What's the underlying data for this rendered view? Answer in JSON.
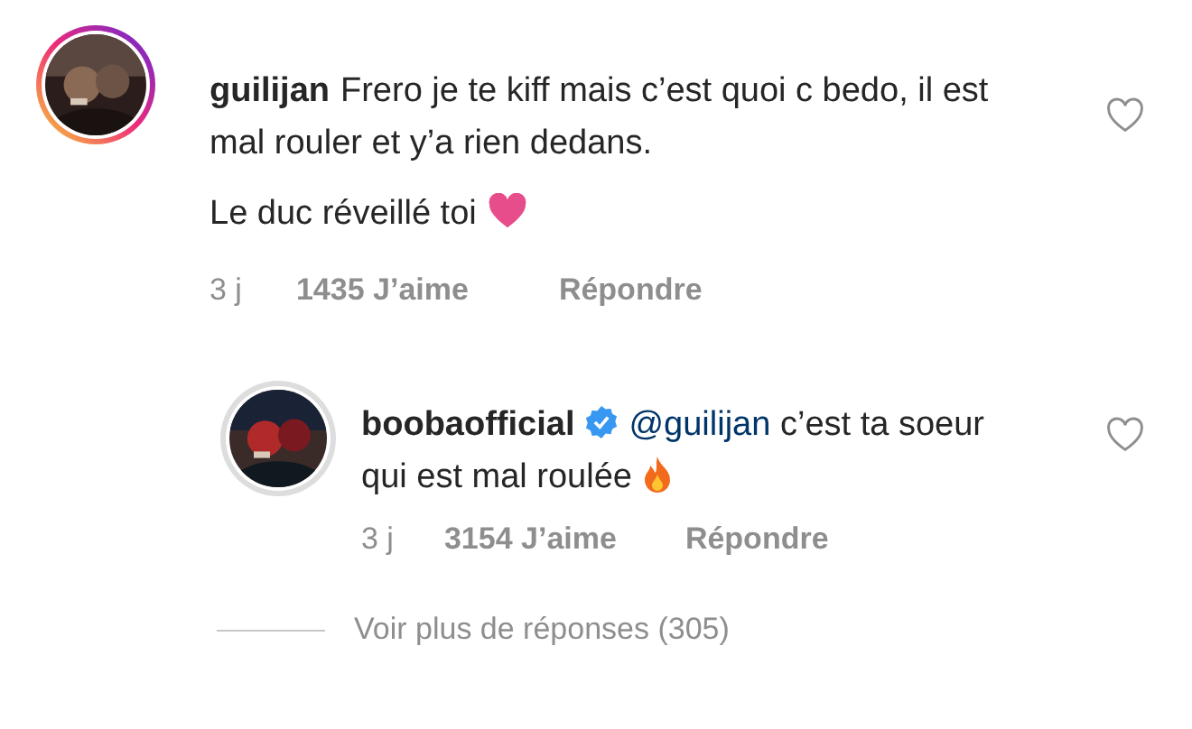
{
  "comments": [
    {
      "username": "guilijan",
      "verified": false,
      "story_ring": true,
      "lines": [
        "Frero je te kiff mais c’est quoi c bedo, il est mal rouler et y’a rien dedans.",
        "Le duc réveillé toi"
      ],
      "end_icon": {
        "kind": "heart"
      },
      "time": "3 j",
      "likes": "1435 J’aime",
      "reply": "Répondre",
      "liked": false
    },
    {
      "username": "boobaofficial",
      "verified": true,
      "story_ring": false,
      "mention": "@guilijan",
      "lines": [
        "c’est ta soeur qui est mal roulée"
      ],
      "end_icon": {
        "kind": "fire"
      },
      "time": "3 j",
      "likes": "3154 J’aime",
      "reply": "Répondre",
      "liked": false
    }
  ],
  "more_replies": "Voir plus de réponses (305)"
}
